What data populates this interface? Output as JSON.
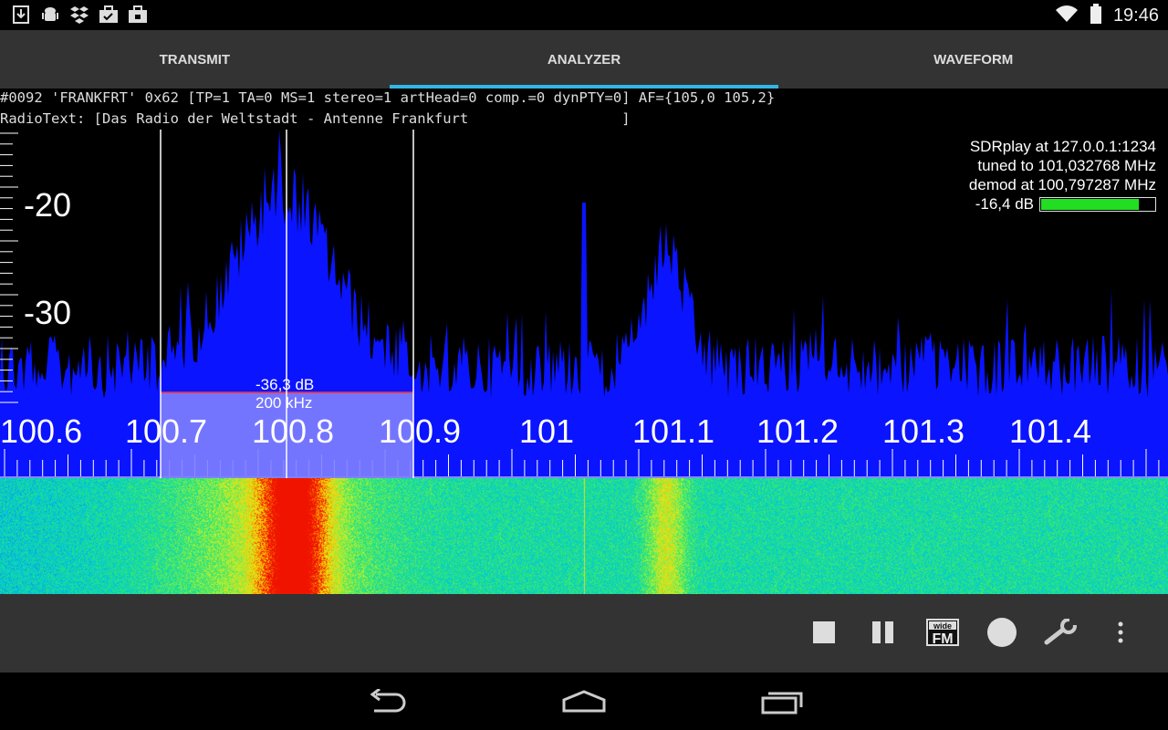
{
  "status_bar": {
    "time": "19:46",
    "left_icons": [
      "download-icon",
      "android-debug-icon",
      "dropbox-icon",
      "briefcase-check-icon",
      "briefcase-icon"
    ],
    "right_icons": [
      "wifi-icon",
      "battery-icon"
    ]
  },
  "tabs": [
    {
      "label": "TRANSMIT",
      "active": false
    },
    {
      "label": "ANALYZER",
      "active": true
    },
    {
      "label": "WAVEFORM",
      "active": false
    }
  ],
  "rds": {
    "line1": "#0092 'FRANKFRT' 0x62 [TP=1 TA=0 MS=1 stereo=1 artHead=0 comp.=0 dynPTY=0] AF={105,0 105,2}",
    "line2": "RadioText: [Das Radio der Weltstadt - Antenne Frankfurt                  ]"
  },
  "analyzer": {
    "source": "SDRplay at 127.0.0.1:1234",
    "tuned": "tuned to 101,032768 MHz",
    "demod": "demod at 100,797287 MHz",
    "level_text": "-16,4 dB",
    "level_fraction": 0.86,
    "db_labels": [
      "-20",
      "-30"
    ],
    "freq_labels": [
      "100.6",
      "100.7",
      "100.8",
      "100.9",
      "101",
      "101.1",
      "101.2",
      "101.3",
      "101.4"
    ],
    "selection_db": "-36,3 dB",
    "selection_bw": "200 kHz",
    "colors": {
      "spectrum": "#0a14ff",
      "selection": "#8080ff",
      "selection_top": "#ff3030",
      "level_fill": "#22dd22",
      "tab_indicator": "#33b5e5"
    }
  },
  "toolbar": {
    "actions": [
      "stop-icon",
      "pause-icon",
      "wide-fm-icon",
      "record-icon",
      "wrench-icon",
      "overflow-menu-icon"
    ],
    "wide_fm_top": "wide",
    "wide_fm_bottom": "FM"
  },
  "nav": {
    "buttons": [
      "back-icon",
      "home-icon",
      "recents-icon"
    ]
  }
}
